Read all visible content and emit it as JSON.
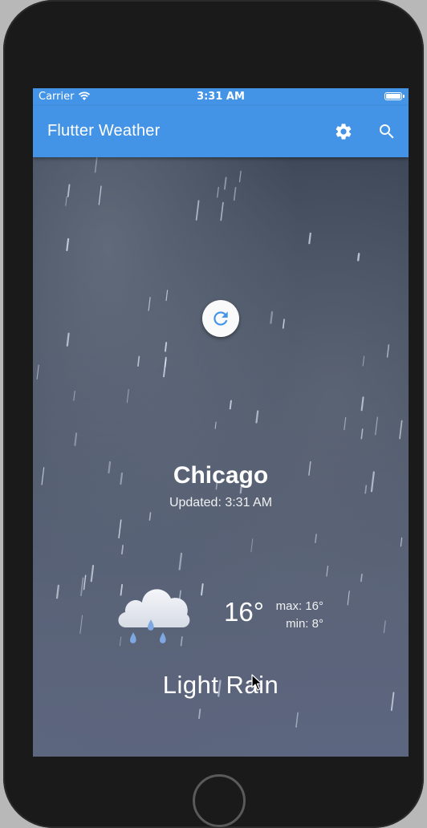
{
  "status_bar": {
    "carrier": "Carrier",
    "time": "3:31 AM"
  },
  "app_bar": {
    "title": "Flutter Weather",
    "settings_icon": "gear-icon",
    "search_icon": "search-icon"
  },
  "weather": {
    "city": "Chicago",
    "updated": "Updated: 3:31 AM",
    "temperature": "16°",
    "max": "max: 16°",
    "min": "min: 8°",
    "condition": "Light Rain",
    "icon": "rain-cloud-icon"
  },
  "colors": {
    "app_bar": "#4393e6",
    "refresh_icon": "#4393e6",
    "text": "#ffffff"
  }
}
